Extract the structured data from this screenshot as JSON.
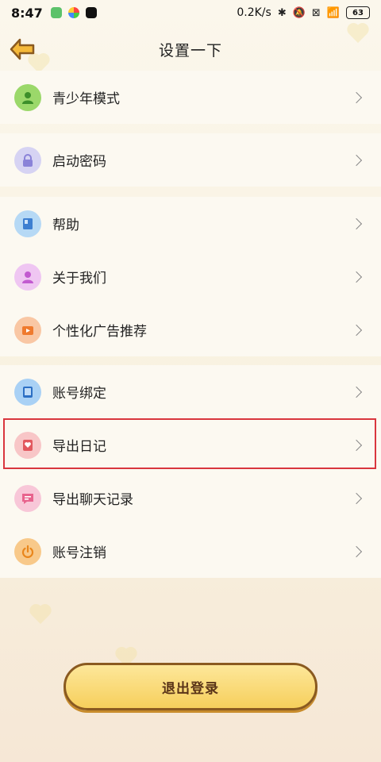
{
  "status_bar": {
    "time": "8:47",
    "speed": "0.2K/s",
    "battery": "63",
    "icons": [
      "wechat-icon",
      "colorful-app-icon",
      "tiktok-icon",
      "bluetooth-icon",
      "mute-icon",
      "sim-icon",
      "wifi-icon",
      "battery-icon"
    ]
  },
  "header": {
    "title": "设置一下",
    "back_icon": "back-arrow-icon"
  },
  "groups": [
    {
      "items": [
        {
          "label": "青少年模式",
          "icon": "person-icon",
          "color": "#9bd86a"
        }
      ]
    },
    {
      "items": [
        {
          "label": "启动密码",
          "icon": "lock-icon",
          "color": "#b9b4ec"
        }
      ]
    },
    {
      "items": [
        {
          "label": "帮助",
          "icon": "book-icon",
          "color": "#8fc3f0"
        },
        {
          "label": "关于我们",
          "icon": "person-icon",
          "color": "#e3a4e8"
        },
        {
          "label": "个性化广告推荐",
          "icon": "play-icon",
          "color": "#f7a56e"
        }
      ]
    },
    {
      "items": [
        {
          "label": "账号绑定",
          "icon": "tablet-icon",
          "color": "#74b5ee"
        },
        {
          "label": "导出日记",
          "icon": "diary-icon",
          "color": "#f6a6a8"
        },
        {
          "label": "导出聊天记录",
          "icon": "chat-icon",
          "color": "#f6a6c6"
        },
        {
          "label": "账号注销",
          "icon": "power-icon",
          "color": "#f7b456"
        }
      ]
    }
  ],
  "logout": {
    "label": "退出登录"
  }
}
